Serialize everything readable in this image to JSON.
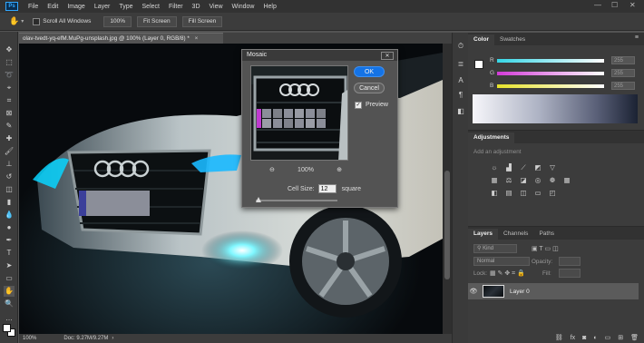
{
  "app": {
    "logo_label": "Ps",
    "menu": [
      "File",
      "Edit",
      "Image",
      "Layer",
      "Type",
      "Select",
      "Filter",
      "3D",
      "View",
      "Window",
      "Help"
    ],
    "window_controls": {
      "minimize": "—",
      "maximize": "☐",
      "close": "✕"
    }
  },
  "options_bar": {
    "scroll_all_windows_label": "Scroll All Windows",
    "zoom_100_label": "100%",
    "fit_screen_label": "Fit Screen",
    "fill_screen_label": "Fill Screen"
  },
  "document": {
    "tab_title": "olav-tvedt-yq-efM.MuPg-unsplash.jpg @ 100% (Layer 0, RGB/8) *",
    "zoom_status": "100%",
    "doc_size": "Doc: 9.27M/9.27M"
  },
  "color_panel": {
    "tabs": [
      "Color",
      "Swatches"
    ],
    "sliders": [
      {
        "letter": "R",
        "value": "255",
        "color": "#36d6e6"
      },
      {
        "letter": "G",
        "value": "255",
        "color": "#d23ad7"
      },
      {
        "letter": "B",
        "value": "255",
        "color": "#e6e22a"
      }
    ]
  },
  "adjustments_panel": {
    "title": "Adjustments",
    "hint": "Add an adjustment"
  },
  "layers_panel": {
    "tabs": [
      "Layers",
      "Channels",
      "Paths"
    ],
    "kind_filter": "Kind",
    "blend_mode": "Normal",
    "opacity_label": "Opacity:",
    "lock_label": "Lock:",
    "fill_label": "Fill:",
    "layer_name": "Layer 0"
  },
  "mosaic_dialog": {
    "title": "Mosaic",
    "ok_label": "OK",
    "cancel_label": "Cancel",
    "preview_label": "Preview",
    "zoom_value": "100%",
    "cell_size_label": "Cell Size:",
    "cell_size_value": "12",
    "cell_unit": "square",
    "accent_color": "#1473e6"
  }
}
